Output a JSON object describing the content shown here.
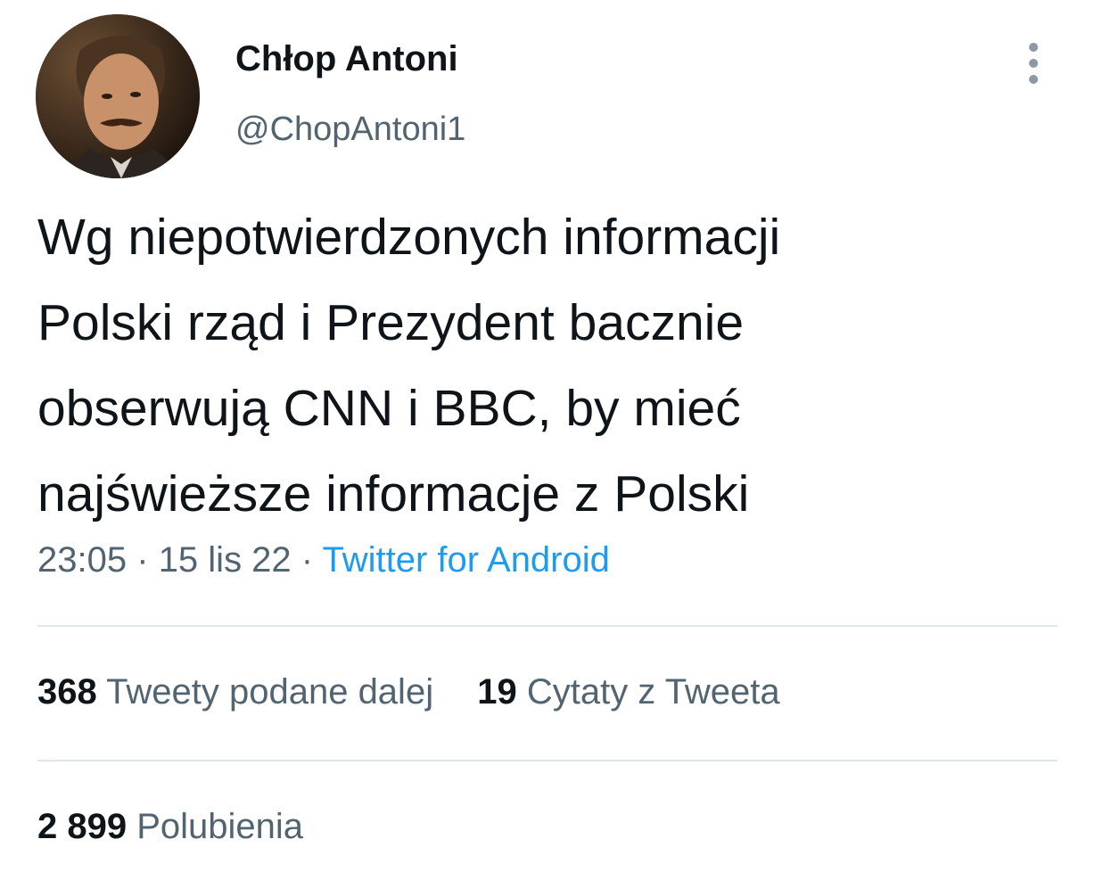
{
  "author": {
    "display_name": "Chłop Antoni",
    "handle": "@ChopAntoni1",
    "avatar_icon": "user-avatar-photo"
  },
  "more_icon": "more-vertical-icon",
  "tweet": {
    "text_lines": [
      "Wg niepotwierdzonych informacji",
      "Polski rząd i Prezydent bacznie",
      "obserwują CNN i BBC, by mieć",
      "najświeższe informacje z Polski"
    ],
    "time": "23:05",
    "date": "15 lis 22",
    "separator": "·",
    "source": "Twitter for Android"
  },
  "stats": {
    "retweets_count": "368",
    "retweets_label": "Tweety podane dalej",
    "quotes_count": "19",
    "quotes_label": "Cytaty z Tweeta",
    "likes_count": "2 899",
    "likes_label": "Polubienia"
  },
  "colors": {
    "text": "#0f1419",
    "secondary": "#536471",
    "link": "#1d9bf0",
    "divider": "#e1e6ea"
  }
}
